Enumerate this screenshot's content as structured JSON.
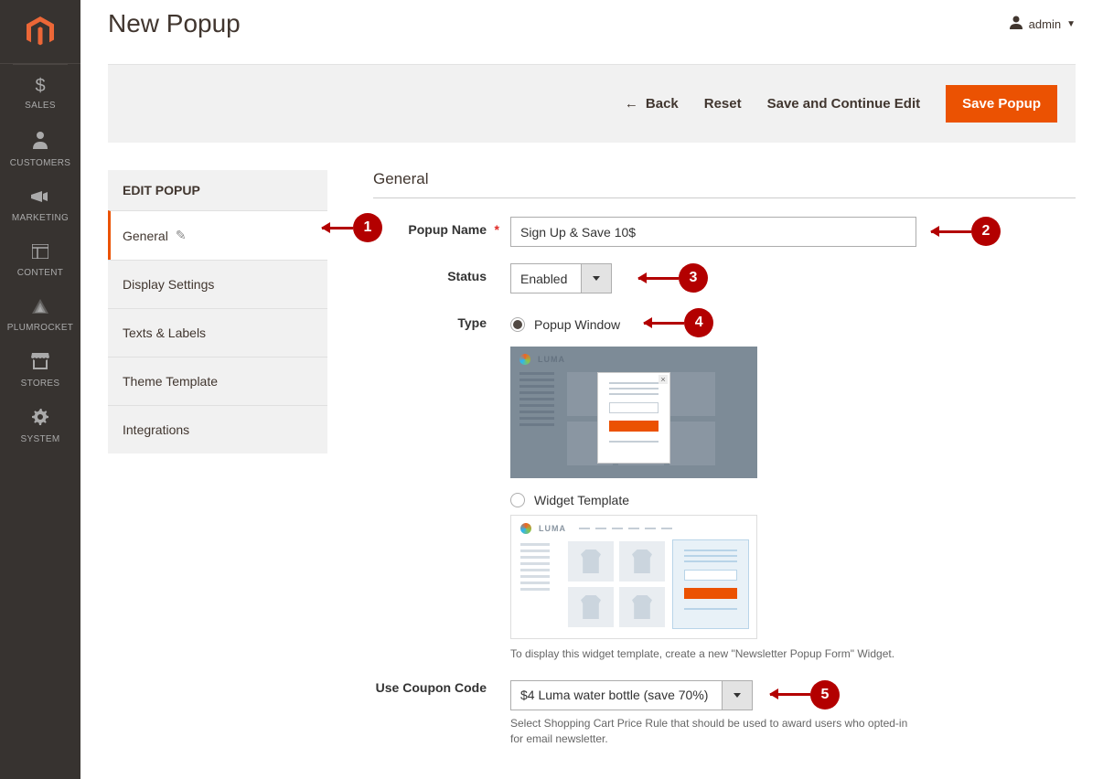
{
  "header": {
    "page_title": "New Popup",
    "user_name": "admin"
  },
  "sidebar_nav": {
    "items": [
      {
        "label": "SALES",
        "icon": "$"
      },
      {
        "label": "CUSTOMERS",
        "icon": "person"
      },
      {
        "label": "MARKETING",
        "icon": "megaphone"
      },
      {
        "label": "CONTENT",
        "icon": "layout"
      },
      {
        "label": "PLUMROCKET",
        "icon": "triangle"
      },
      {
        "label": "STORES",
        "icon": "store"
      },
      {
        "label": "SYSTEM",
        "icon": "gear"
      }
    ]
  },
  "toolbar": {
    "back_label": "Back",
    "reset_label": "Reset",
    "save_continue_label": "Save and Continue Edit",
    "save_label": "Save Popup"
  },
  "tabs": {
    "title": "EDIT POPUP",
    "items": [
      {
        "label": "General",
        "active": true
      },
      {
        "label": "Display Settings",
        "active": false
      },
      {
        "label": "Texts & Labels",
        "active": false
      },
      {
        "label": "Theme Template",
        "active": false
      },
      {
        "label": "Integrations",
        "active": false
      }
    ]
  },
  "form": {
    "section_title": "General",
    "popup_name": {
      "label": "Popup Name",
      "value": "Sign Up & Save 10$"
    },
    "status": {
      "label": "Status",
      "value": "Enabled"
    },
    "type": {
      "label": "Type",
      "options": [
        {
          "label": "Popup Window",
          "checked": true
        },
        {
          "label": "Widget Template",
          "checked": false
        }
      ],
      "widget_help": "To display this widget template, create a new \"Newsletter Popup Form\" Widget."
    },
    "coupon": {
      "label": "Use Coupon Code",
      "value": "$4 Luma water bottle (save 70%)",
      "help": "Select Shopping Cart Price Rule that should be used to award users who opted-in for email newsletter."
    },
    "preview_brand": "LUMA"
  },
  "callouts": {
    "c1": "1",
    "c2": "2",
    "c3": "3",
    "c4": "4",
    "c5": "5"
  }
}
